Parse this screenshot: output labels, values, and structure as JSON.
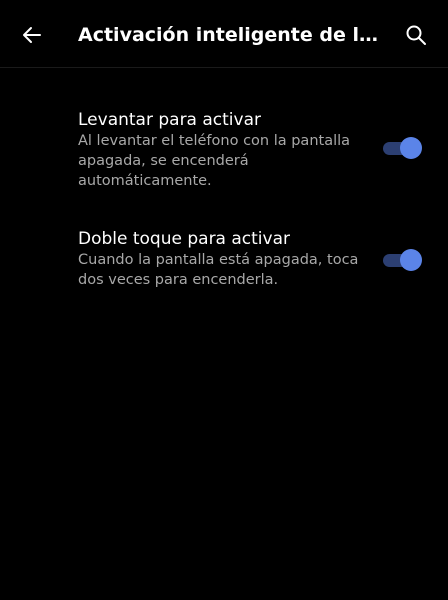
{
  "header": {
    "title": "Activación inteligente de la pan…",
    "back_icon": "arrow-left-icon",
    "search_icon": "search-icon"
  },
  "settings": [
    {
      "title": "Levantar para activar",
      "summary": "Al levantar el teléfono con la pantalla apagada, se encenderá automáticamente.",
      "enabled": true
    },
    {
      "title": "Doble toque para activar",
      "summary": "Cuando la pantalla está apagada, toca dos veces para encenderla.",
      "enabled": true
    }
  ],
  "colors": {
    "background": "#000000",
    "accent": "#5b84e8",
    "track": "#2c3f72",
    "secondary_text": "#a8a8a8"
  }
}
